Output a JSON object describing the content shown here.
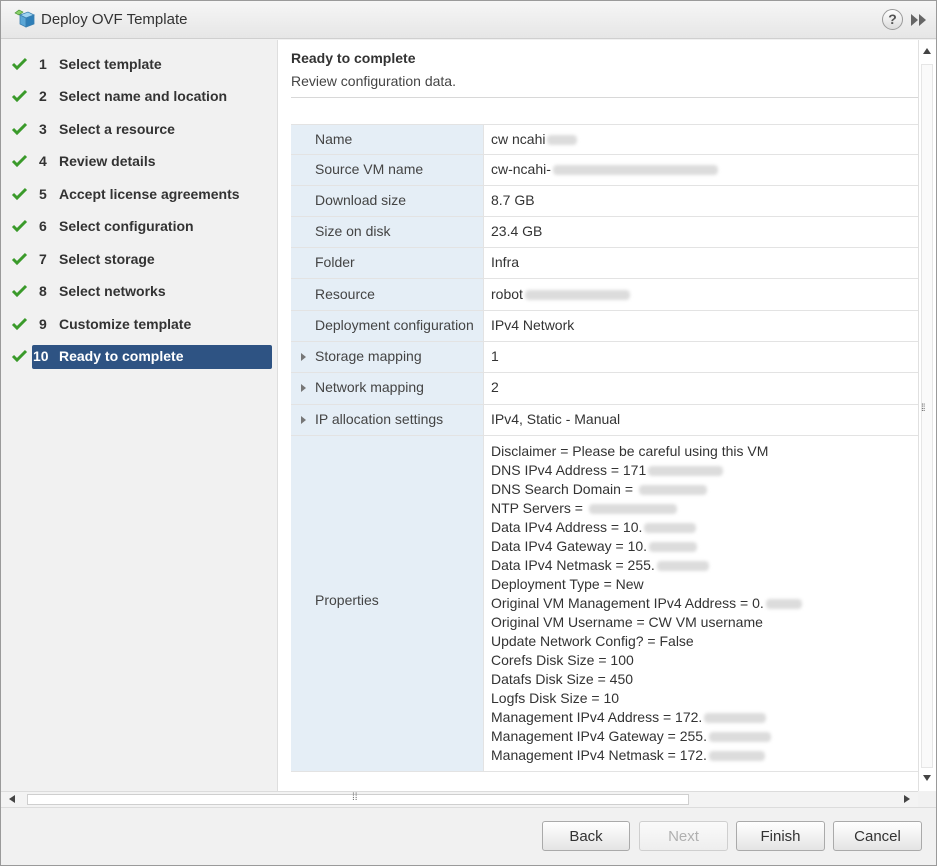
{
  "window": {
    "title": "Deploy OVF Template",
    "help_label": "?"
  },
  "steps": [
    {
      "num": "1",
      "label": "Select template"
    },
    {
      "num": "2",
      "label": "Select name and location"
    },
    {
      "num": "3",
      "label": "Select a resource"
    },
    {
      "num": "4",
      "label": "Review details"
    },
    {
      "num": "5",
      "label": "Accept license agreements"
    },
    {
      "num": "6",
      "label": "Select configuration"
    },
    {
      "num": "7",
      "label": "Select storage"
    },
    {
      "num": "8",
      "label": "Select networks"
    },
    {
      "num": "9",
      "label": "Customize template"
    },
    {
      "num": "10",
      "label": "Ready to complete"
    }
  ],
  "main": {
    "title": "Ready to complete",
    "subtitle": "Review configuration data.",
    "rows": [
      {
        "key": "Name",
        "value": "cw ncahi"
      },
      {
        "key": "Source VM name",
        "value": "cw-ncahi-"
      },
      {
        "key": "Download size",
        "value": "8.7 GB"
      },
      {
        "key": "Size on disk",
        "value": "23.4 GB"
      },
      {
        "key": "Folder",
        "value": "Infra"
      },
      {
        "key": "Resource",
        "value": "robot"
      },
      {
        "key": "Deployment configuration",
        "value": "IPv4 Network"
      },
      {
        "key": "Storage mapping",
        "value": "1"
      },
      {
        "key": "Network mapping",
        "value": "2"
      },
      {
        "key": "IP allocation settings",
        "value": "IPv4, Static - Manual"
      }
    ],
    "properties_key": "Properties",
    "properties": [
      "Disclaimer = Please be careful using this VM",
      "DNS IPv4 Address = 171",
      "DNS Search Domain =",
      "NTP Servers =",
      "Data IPv4 Address = 10.",
      "Data IPv4 Gateway = 10.",
      "Data IPv4 Netmask = 255.",
      "Deployment Type = New",
      "Original VM Management IPv4 Address = 0.",
      "Original VM Username = CW VM username",
      "Update Network Config? = False",
      "Corefs Disk Size = 100",
      "Datafs Disk Size = 450",
      "Logfs Disk Size = 10",
      "Management IPv4 Address = 172.",
      "Management IPv4 Gateway = 255.",
      "Management IPv4 Netmask = 172."
    ]
  },
  "footer": {
    "back": "Back",
    "next": "Next",
    "finish": "Finish",
    "cancel": "Cancel"
  },
  "colors": {
    "active_step_bg": "#2e5383",
    "check_green": "#3a9a2a",
    "key_cell_bg": "#e5eef6"
  }
}
